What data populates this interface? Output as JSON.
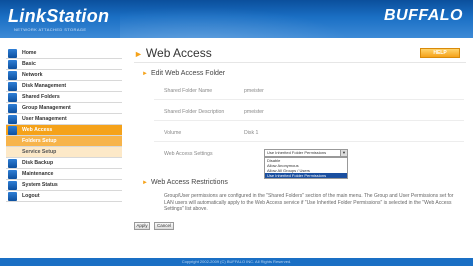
{
  "header": {
    "logo": "LinkStation",
    "logo_sub": "NETWORK ATTACHED STORAGE",
    "brand": "BUFFALO"
  },
  "sidebar": {
    "items": [
      {
        "label": "Home",
        "icon": "home-icon"
      },
      {
        "label": "Basic",
        "icon": "basic-icon"
      },
      {
        "label": "Network",
        "icon": "network-icon"
      },
      {
        "label": "Disk Management",
        "icon": "disk-icon"
      },
      {
        "label": "Shared Folders",
        "icon": "folder-icon"
      },
      {
        "label": "Group Management",
        "icon": "group-icon"
      },
      {
        "label": "User Management",
        "icon": "user-icon"
      },
      {
        "label": "Web Access",
        "icon": "web-icon"
      },
      {
        "label": "Folders Setup"
      },
      {
        "label": "Service Setup"
      },
      {
        "label": "Disk Backup",
        "icon": "backup-icon"
      },
      {
        "label": "Maintenance",
        "icon": "maintenance-icon"
      },
      {
        "label": "System Status",
        "icon": "status-icon"
      },
      {
        "label": "Logout",
        "icon": "logout-icon"
      }
    ]
  },
  "main": {
    "title": "Web Access",
    "help": "HELP",
    "edit_section_title": "Edit Web Access Folder",
    "fields": [
      {
        "label": "Shared Folder Name",
        "value": "pmeister"
      },
      {
        "label": "Shared Folder Description",
        "value": "pmeister"
      },
      {
        "label": "Volume",
        "value": "Disk 1"
      },
      {
        "label": "Web Access Settings",
        "value": ""
      }
    ],
    "select": {
      "selected": "Use Inherited Folder Permissions",
      "options": [
        "Disable",
        "Allow Anonymous",
        "Allow All Groups / Users",
        "Use Inherited Folder Permissions"
      ]
    },
    "restrictions_title": "Web Access Restrictions",
    "restrictions_text": "Group/User permissions are configured in the \"Shared Folders\" section of the main menu. The Group and User Permissions set for LAN users will automatically apply to the Web Access service if \"Use Inherited Folder Permissions\" is selected in the \"Web Access Settings\" list above.",
    "apply_label": "Apply",
    "cancel_label": "Cancel"
  },
  "footer": {
    "text": "Copyright 2002-2009 (C) BUFFALO INC. All Rights Reserved."
  }
}
